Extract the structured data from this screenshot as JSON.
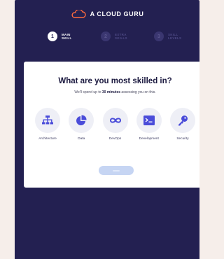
{
  "brand": {
    "name": "A CLOUD GURU",
    "logo_color": "#ff6a3d"
  },
  "steps": [
    {
      "number": "1",
      "label": "MAIN\nSKILL",
      "state": "active"
    },
    {
      "number": "2",
      "label": "EXTRA\nSKILLS",
      "state": "inactive"
    },
    {
      "number": "3",
      "label": "SKILL\nLEVELS",
      "state": "inactive"
    }
  ],
  "card": {
    "title": "What are you most skilled in?",
    "subtitle_before": "We'll spend up to ",
    "subtitle_bold": "30 minutes",
    "subtitle_after": " assessing you on this."
  },
  "skills": [
    {
      "label": "Architecture",
      "icon": "hierarchy-icon"
    },
    {
      "label": "Data",
      "icon": "pie-chart-icon"
    },
    {
      "label": "DevOps",
      "icon": "infinity-icon"
    },
    {
      "label": "Development",
      "icon": "terminal-icon"
    },
    {
      "label": "Security",
      "icon": "key-icon"
    }
  ],
  "colors": {
    "background": "#232051",
    "accent": "#4a4cd9",
    "button_disabled": "#c6d5f3"
  }
}
